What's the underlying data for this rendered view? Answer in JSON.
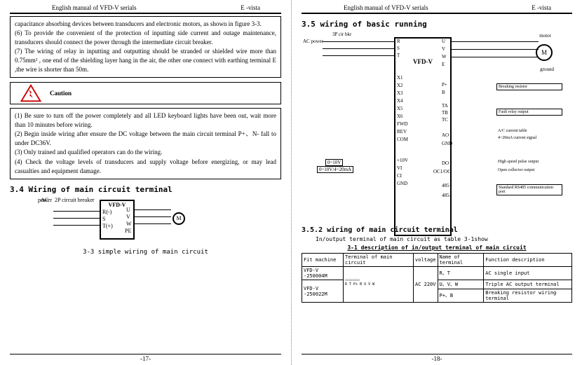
{
  "header": {
    "title": "English manual of VFD-V serials",
    "brand": "E -vista"
  },
  "left": {
    "box1": {
      "intro": "capacitance absorbing devices between transducers and electronic motors, as shown in figure 3-3.",
      "i6": "(6) To provide the convenient of the protection of inputting side current and outage maintenance, transducers should connect the power through the intermediate circuit breaker.",
      "i7": "(7) The wiring of relay in inputting and outputting should be stranded or shielded wire more than 0.75mm² , one end of the shielding layer hang in the air, the other one connect with earthing terminal E ,the wire is shorter than 50m."
    },
    "caution": "Caution",
    "box2": {
      "i1": "(1) Be sure to turn off the power completely and all LED keyboard lights have been out, wait more than 10 minutes before wiring.",
      "i2": "(2) Begin inside wiring after ensure the DC voltage between the main circuit terminal P+、N- fall to under DC36V.",
      "i3": "(3) Only trained and qualified operators can do the wiring.",
      "i4": "(4) Check the voltage levels of transducers and supply voltage before energizing, or may lead casualties and equipment damage."
    },
    "sec34": "3.4 Wiring of main circuit terminal",
    "d1": {
      "breaker": "2P circuit breaker",
      "ac": "AC",
      "power": "power",
      "vfd": "VFD-V",
      "R": "R(-)",
      "S": "S",
      "T": "T(+)",
      "U": "U",
      "V": "V",
      "W": "W",
      "PE": "PE",
      "M": "M",
      "cap": "3-3  simple wiring of main circuit"
    },
    "pageno": "-17-"
  },
  "right": {
    "sec35": "3.5 wiring of basic running",
    "d2": {
      "breaker": "3P cir bkr",
      "acpower": "AC power",
      "vfd": "VFD-V",
      "R": "R",
      "S": "S",
      "T": "T",
      "U": "U",
      "V": "V",
      "W": "W",
      "E": "E",
      "X1": "X1",
      "X2": "X2",
      "X3": "X3",
      "X4": "X4",
      "X5": "X5",
      "X6": "X6",
      "FWD": "FWD",
      "REV": "REV",
      "COM": "COM",
      "Pp": "P+",
      "B": "B",
      "TA": "TA",
      "TB": "TB",
      "TC": "TC",
      "AO": "AO",
      "GND": "GND",
      "DO": "DO",
      "OC": "OC1/OC",
      "485p": "485+",
      "485m": "485-",
      "p10v": "+10V",
      "VI": "VI",
      "CI": "CI",
      "sig1": "0~10V",
      "sig2": "0~10V/4~20mA",
      "motor": "motor",
      "M": "M",
      "ground": "ground",
      "brk": "Breaking resistor",
      "relay": "Fault relay output",
      "acct": "A/C current table",
      "acsig": "4~20mA current signal",
      "hsp": "High speed pulse output",
      "oco": "Open collector output",
      "rs": "Standard RS485 communication port"
    },
    "sec352": "3.5.2  wiring of main circuit terminal",
    "note": "In/output terminal of main circuit as table 3-1show",
    "tblhdr": "3-1  description of in/output terminal of main circuit",
    "tbl": {
      "h1": "Fit machine",
      "h2": "Terminal of main circuit",
      "h3": "voltage",
      "h4": "Name of terminal",
      "h5": "Function description",
      "r1c1": "VFD-V -250004M",
      "r2c1": "VFD-V -250022M",
      "termlabels": "R  T P+ B  U V W",
      "volt": "AC 220V",
      "n1": "R、T",
      "f1": "AC single input",
      "n2": "U、V、W",
      "f2": "Triple AC output terminal",
      "n3": "P+、B",
      "f3": "Breaking resistor wiring terminal"
    },
    "pageno": "-18-"
  }
}
